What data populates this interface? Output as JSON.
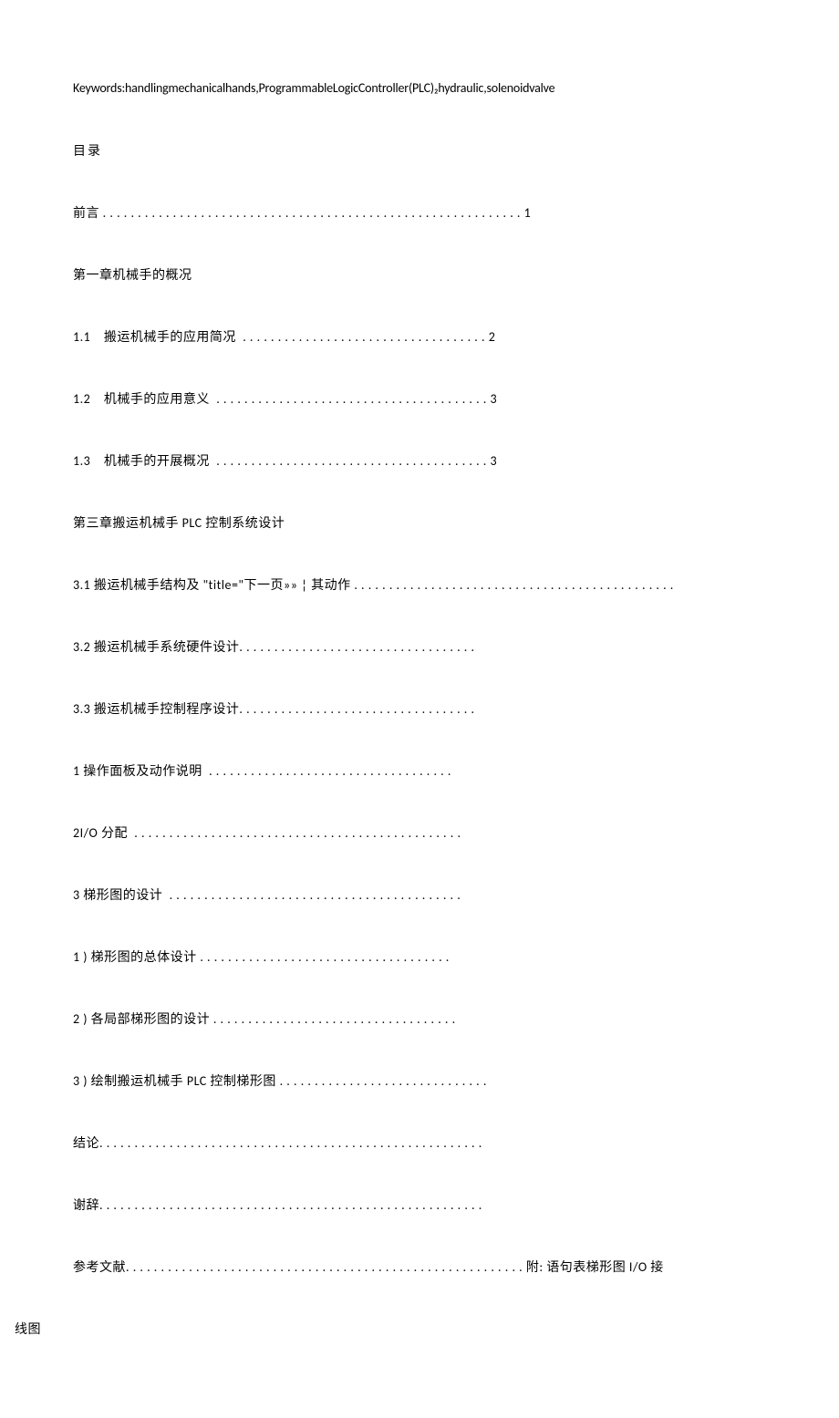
{
  "keywords": "Keywords:handlingmechanicalhands,ProgrammableLogicController(PLC)₂hydraulic,solenoidvalve",
  "tocTitle": "目录",
  "lines": [
    "前言 . . . . . . . . . . . . . . . . . . . . . . . . . . . . . . . . . . . . . . . . . . . . . . . . . . . . . . . . . . . . 1",
    "第一章机械手的概况",
    "1.1    搬运机械手的应用简况  . . . . . . . . . . . . . . . . . . . . . . . . . . . . . . . . . . . 2",
    "1.2    机械手的应用意义  . . . . . . . . . . . . . . . . . . . . . . . . . . . . . . . . . . . . . . . 3",
    "1.3    机械手的开展概况  . . . . . . . . . . . . . . . . . . . . . . . . . . . . . . . . . . . . . . . 3",
    "第三章搬运机械手 PLC 控制系统设计",
    "3.1 搬运机械手结构及 \"title=\"下一页»» ¦ 其动作 . . . . . . . . . . . . . . . . . . . . . . . . . . . . . . . . . . . . . . . . . . . . . .",
    "3.2 搬运机械手系统硬件设计. . . . . . . . . . . . . . . . . . . . . . . . . . . . . . . . . .",
    "3.3 搬运机械手控制程序设计. . . . . . . . . . . . . . . . . . . . . . . . . . . . . . . . . .",
    "1 操作面板及动作说明  . . . . . . . . . . . . . . . . . . . . . . . . . . . . . . . . . . .",
    "2I/O 分配  . . . . . . . . . . . . . . . . . . . . . . . . . . . . . . . . . . . . . . . . . . . . . . .",
    "3 梯形图的设计  . . . . . . . . . . . . . . . . . . . . . . . . . . . . . . . . . . . . . . . . . .",
    "1 ) 梯形图的总体设计 . . . . . . . . . . . . . . . . . . . . . . . . . . . . . . . . . . . .",
    "2 ) 各局部梯形图的设计 . . . . . . . . . . . . . . . . . . . . . . . . . . . . . . . . . . .",
    "3 ) 绘制搬运机械手 PLC 控制梯形图 . . . . . . . . . . . . . . . . . . . . . . . . . . . . . .",
    "结论. . . . . . . . . . . . . . . . . . . . . . . . . . . . . . . . . . . . . . . . . . . . . . . . . . . . . . .",
    "谢辞. . . . . . . . . . . . . . . . . . . . . . . . . . . . . . . . . . . . . . . . . . . . . . . . . . . . . . .",
    "参考文献. . . . . . . . . . . . . . . . . . . . . . . . . . . . . . . . . . . . . . . . . . . . . . . . . . . . . . . . . 附: 语句表梯形图 I/O 接"
  ],
  "lastLine": "线图"
}
